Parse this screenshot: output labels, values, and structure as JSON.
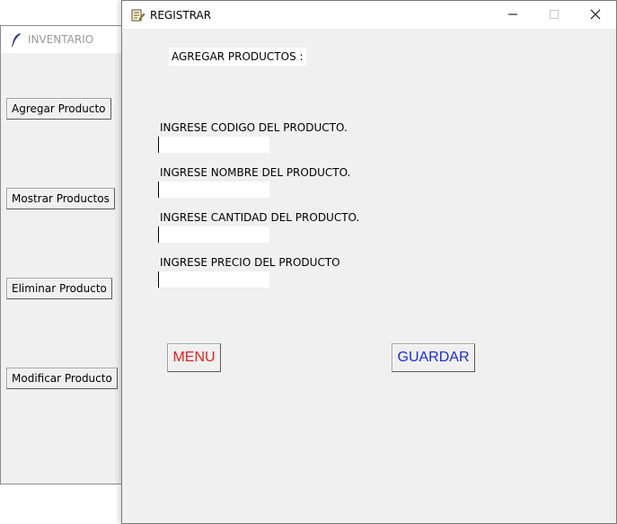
{
  "colors": {
    "menu_text": "#e02020",
    "guardar_text": "#1a2be0",
    "window_bg": "#f0f0f0"
  },
  "background_window": {
    "title": "INVENTARIO",
    "icon": "feather-icon",
    "buttons": [
      {
        "label": "Agregar Producto"
      },
      {
        "label": "Mostrar Productos"
      },
      {
        "label": "Eliminar Producto"
      },
      {
        "label": "Modificar Producto"
      }
    ]
  },
  "main_window": {
    "title": "REGISTRAR",
    "icon": "notepad-icon",
    "controls": [
      "minimize-icon",
      "maximize-icon",
      "close-icon"
    ],
    "section_label": "AGREGAR PRODUCTOS :",
    "fields": [
      {
        "label": "INGRESE CODIGO DEL PRODUCTO.",
        "value": ""
      },
      {
        "label": "INGRESE NOMBRE DEL PRODUCTO.",
        "value": ""
      },
      {
        "label": "INGRESE CANTIDAD DEL PRODUCTO.",
        "value": ""
      },
      {
        "label": "INGRESE PRECIO DEL PRODUCTO",
        "value": ""
      }
    ],
    "buttons": {
      "menu": "MENU",
      "guardar": "GUARDAR"
    }
  }
}
